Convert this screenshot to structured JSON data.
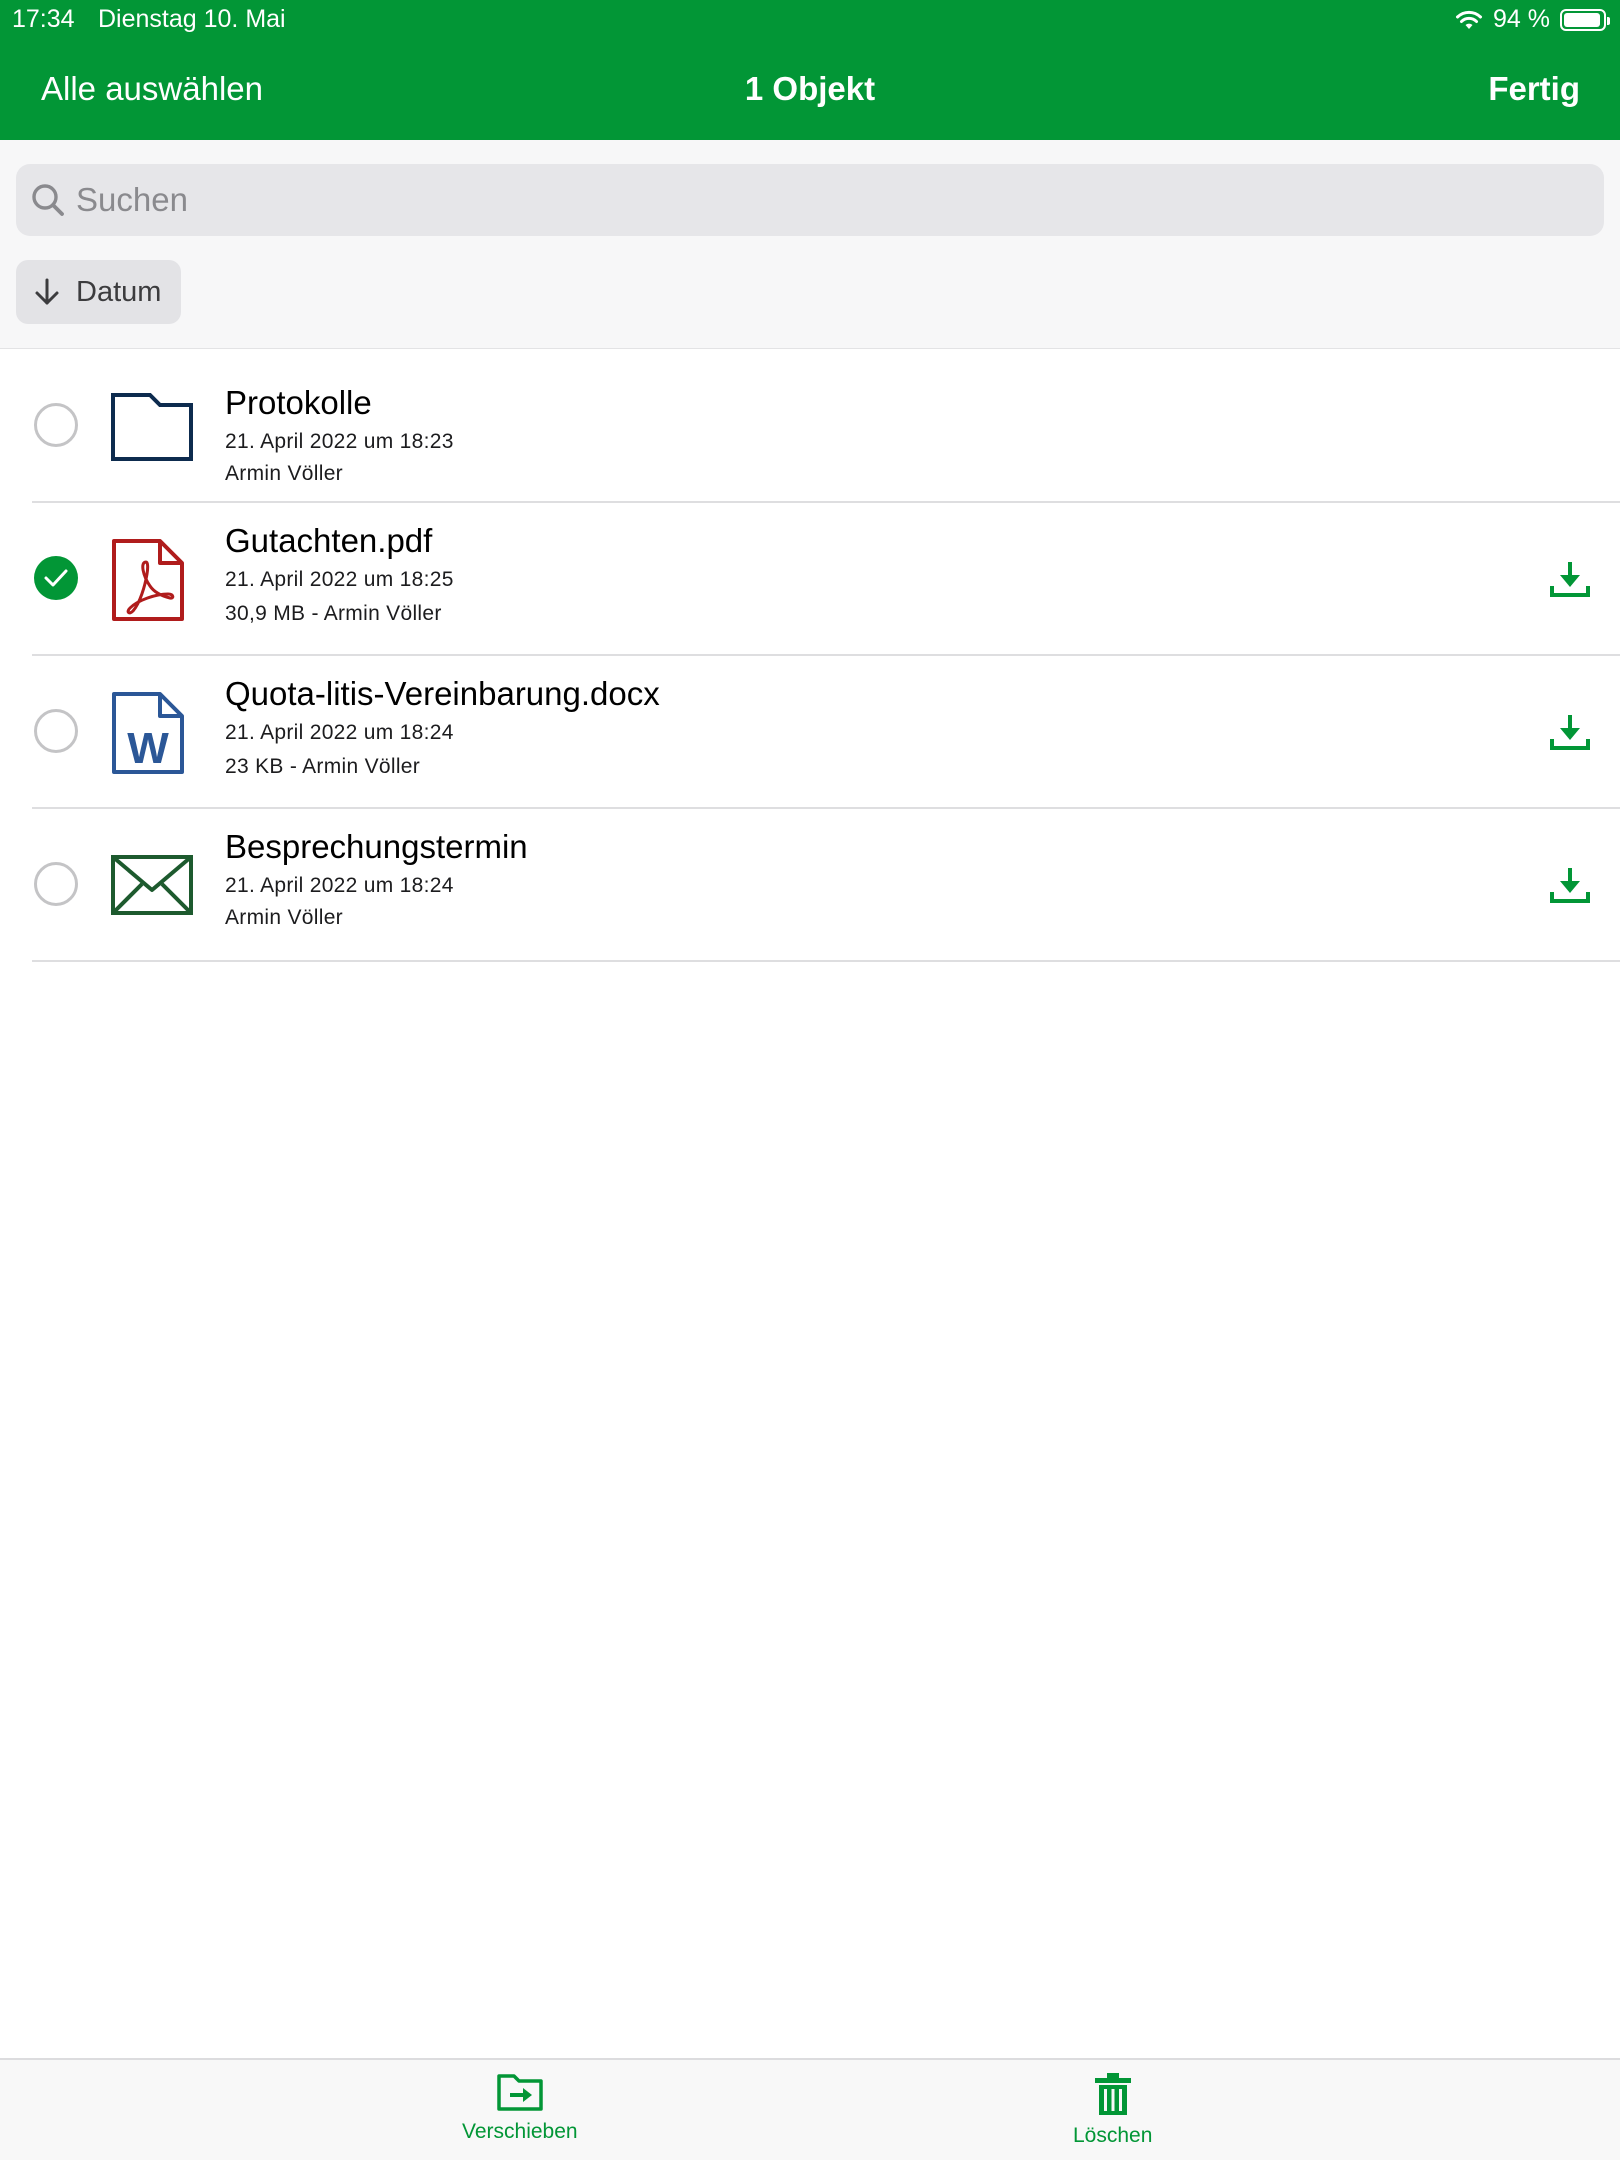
{
  "status_bar": {
    "time": "17:34",
    "date": "Dienstag 10. Mai",
    "battery": "94 %"
  },
  "nav": {
    "select_all": "Alle auswählen",
    "title": "1 Objekt",
    "done": "Fertig"
  },
  "search": {
    "placeholder": "Suchen"
  },
  "sort": {
    "label": "Datum",
    "direction": "descending"
  },
  "files": [
    {
      "name": "Protokolle",
      "date": "21. April 2022 um 18:23",
      "info": "Armin Völler",
      "type": "folder-icon",
      "selected": false,
      "downloadable": false
    },
    {
      "name": "Gutachten.pdf",
      "date": "21. April 2022 um 18:25",
      "info": "30,9 MB  -  Armin Völler",
      "type": "pdf-icon",
      "selected": true,
      "downloadable": true
    },
    {
      "name": "Quota-litis-Vereinbarung.docx",
      "date": "21. April 2022 um 18:24",
      "info": "23 KB  -  Armin Völler",
      "type": "word-icon",
      "selected": false,
      "downloadable": true
    },
    {
      "name": "Besprechungstermin",
      "date": "21. April 2022 um 18:24",
      "info": "Armin Völler",
      "type": "mail-icon",
      "selected": false,
      "downloadable": true
    }
  ],
  "bottom_bar": {
    "move_label": "Verschieben",
    "delete_label": "Löschen"
  },
  "colors": {
    "accent": "#029636",
    "pdf": "#b01c1c",
    "word": "#2b5797",
    "folder": "#0d2b4e",
    "mail": "#1d5a2e"
  }
}
